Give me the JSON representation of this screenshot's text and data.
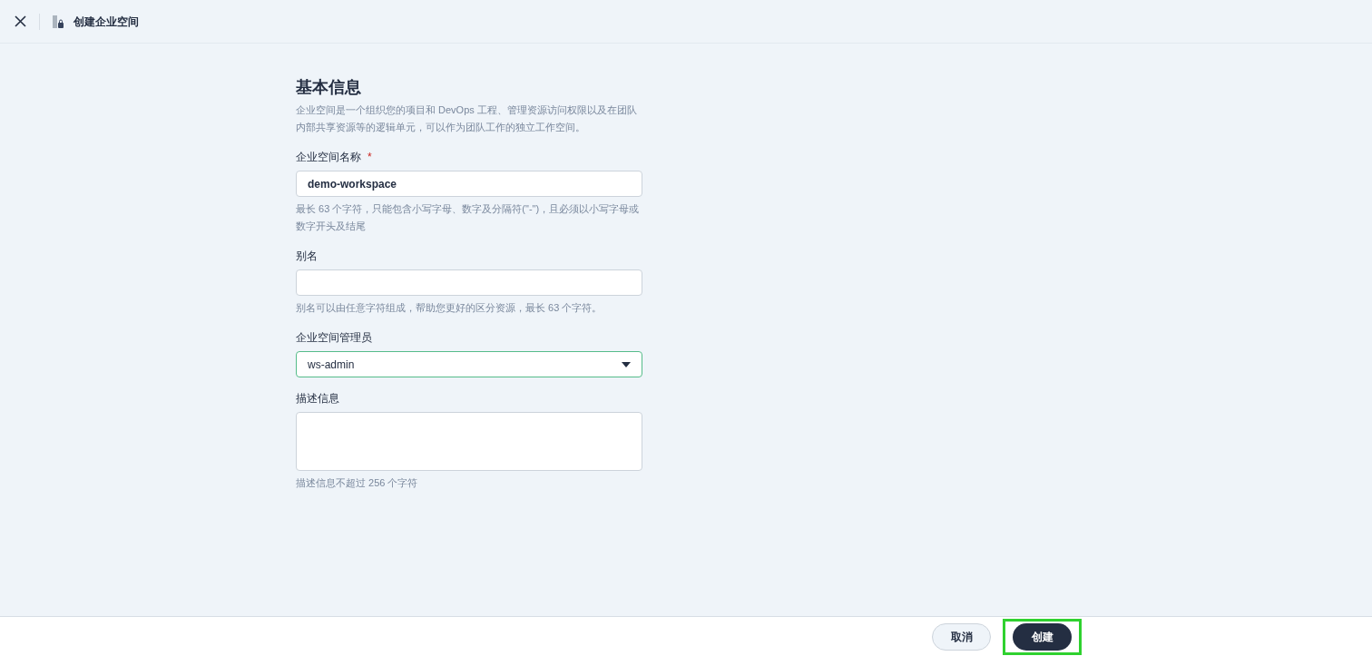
{
  "header": {
    "title": "创建企业空间"
  },
  "section": {
    "title": "基本信息",
    "description": "企业空间是一个组织您的项目和 DevOps 工程、管理资源访问权限以及在团队内部共享资源等的逻辑单元，可以作为团队工作的独立工作空间。"
  },
  "fields": [
    {
      "kind": "text",
      "label": "企业空间名称",
      "required_mark": "*",
      "value": "demo-workspace",
      "hint": "最长 63 个字符，只能包含小写字母、数字及分隔符(\"-\")，且必须以小写字母或数字开头及结尾"
    },
    {
      "kind": "text",
      "label": "别名",
      "hint": "别名可以由任意字符组成，帮助您更好的区分资源，最长 63 个字符。"
    },
    {
      "kind": "select",
      "label": "企业空间管理员",
      "value": "ws-admin"
    },
    {
      "kind": "textarea",
      "label": "描述信息",
      "hint": "描述信息不超过 256 个字符"
    }
  ],
  "footer": {
    "buttons": [
      {
        "label": "取消",
        "kind": "secondary",
        "highlighted": false
      },
      {
        "label": "创建",
        "kind": "primary",
        "highlighted": true
      }
    ]
  }
}
